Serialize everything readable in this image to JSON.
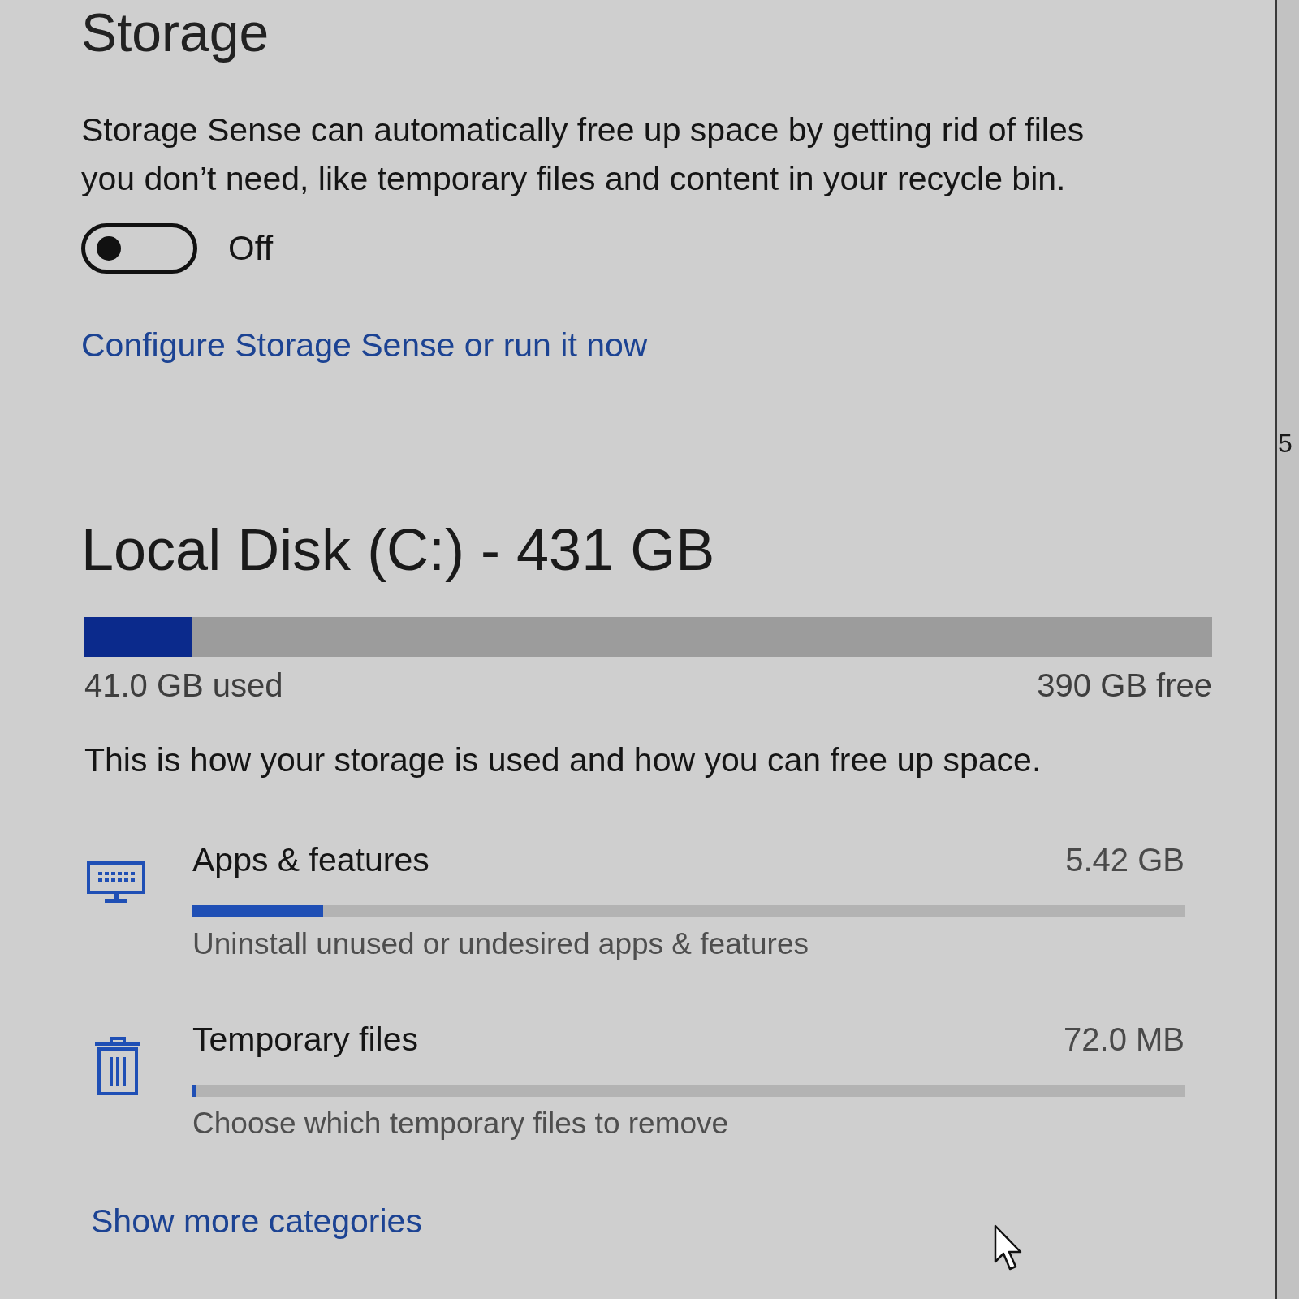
{
  "page": {
    "title": "Storage"
  },
  "storage_sense": {
    "description": "Storage Sense can automatically free up space by getting rid of files you don’t need, like temporary files and content in your recycle bin.",
    "toggle": {
      "on": false,
      "label": "Off"
    },
    "link": "Configure Storage Sense or run it now"
  },
  "disk": {
    "title": "Local Disk (C:) - 431 GB",
    "level": 0.095,
    "used": "41.0 GB used",
    "free": "390 GB free"
  },
  "usage_intro": "This is how your storage is used and how you can free up space.",
  "categories": [
    {
      "kind": "apps",
      "name": "Apps & features",
      "size": "5.42 GB",
      "level": 0.132,
      "hint": "Uninstall unused or undesired apps & features"
    },
    {
      "kind": "temp",
      "name": "Temporary files",
      "size": "72.0 MB",
      "level": 0.004,
      "hint": "Choose which temporary files to remove"
    }
  ],
  "show_more_link": "Show more categories",
  "side_panel": {
    "text_fragment": "5"
  }
}
